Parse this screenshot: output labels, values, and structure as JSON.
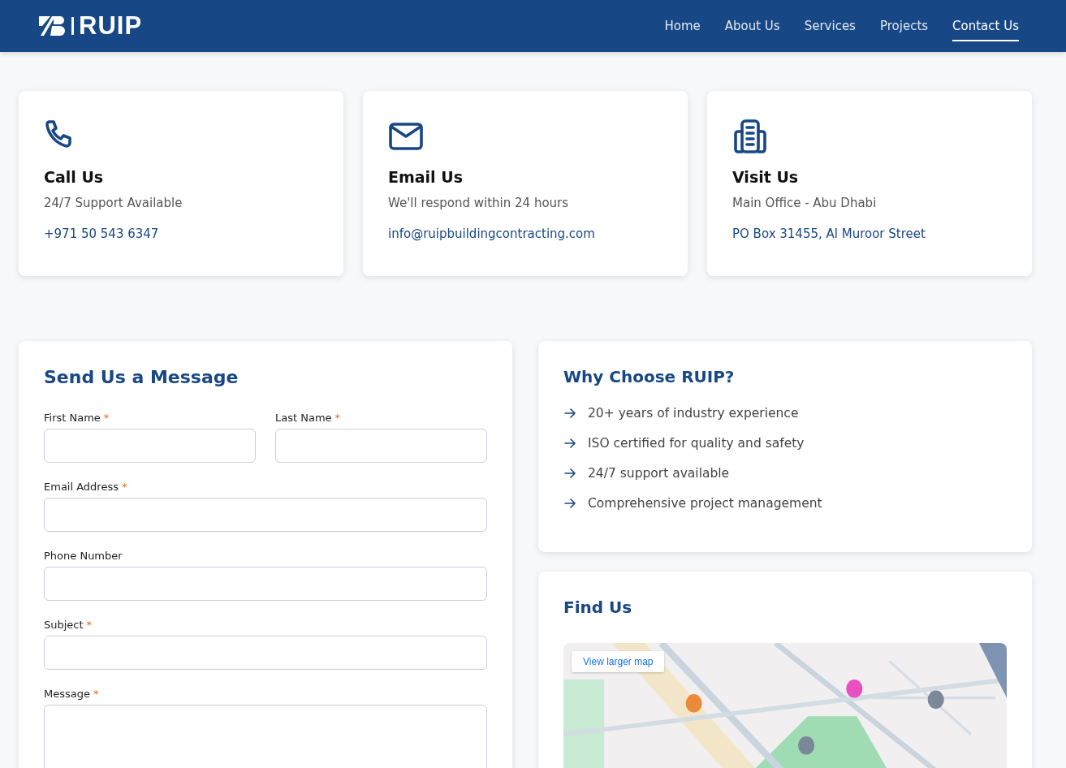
{
  "header": {
    "brand": "RUIP",
    "nav": [
      {
        "label": "Home",
        "selected": false
      },
      {
        "label": "About Us",
        "selected": false
      },
      {
        "label": "Services",
        "selected": false
      },
      {
        "label": "Projects",
        "selected": false
      },
      {
        "label": "Contact Us",
        "selected": true
      }
    ]
  },
  "contact_cards": [
    {
      "kind": "phone",
      "title": "Call Us",
      "subtitle": "24/7 Support Available",
      "link": "+971 50 543 6347"
    },
    {
      "kind": "email",
      "title": "Email Us",
      "subtitle": "We'll respond within 24 hours",
      "link": "info@ruipbuildingcontracting.com"
    },
    {
      "kind": "building",
      "title": "Visit Us",
      "subtitle": "Main Office - Abu Dhabi",
      "link": "PO Box 31455, Al Muroor Street"
    }
  ],
  "form": {
    "title": "Send Us a Message",
    "required_mark": "*",
    "fields": [
      {
        "label": "First Name",
        "required": true,
        "kind": "half"
      },
      {
        "label": "Last Name",
        "required": true,
        "kind": "half"
      },
      {
        "label": "Email Address",
        "required": true,
        "kind": "full"
      },
      {
        "label": "Phone Number",
        "required": false,
        "kind": "full"
      },
      {
        "label": "Subject",
        "required": true,
        "kind": "full"
      },
      {
        "label": "Message",
        "required": true,
        "kind": "area"
      }
    ]
  },
  "why": {
    "title": "Why Choose RUIP?",
    "items": [
      "20+ years of industry experience",
      "ISO certified for quality and safety",
      "24/7 support available",
      "Comprehensive project management"
    ]
  },
  "find_us": {
    "title": "Find Us",
    "map": {
      "kind": "picture",
      "button": "View larger map"
    }
  }
}
